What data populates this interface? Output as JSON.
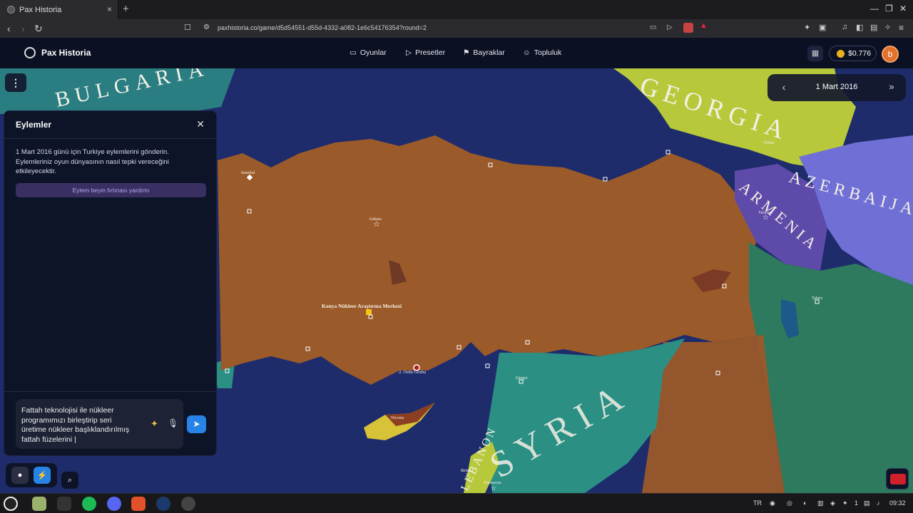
{
  "browser": {
    "tab_title": "Pax Historia",
    "tab_close": "×",
    "new_tab": "+",
    "url": "paxhistoria.co/game/d5d54551-d55d-4332-a082-1e6c54176354?round=2"
  },
  "app": {
    "brand": "Pax Historia",
    "nav": [
      "Oyunlar",
      "Presetler",
      "Bayraklar",
      "Topluluk"
    ],
    "balance": "$0.776",
    "avatar_initial": "b"
  },
  "date": {
    "current": "1 Mart 2016"
  },
  "actions_panel": {
    "title": "Eylemler",
    "description": "1 Mart 2016 günü için Turkiye eylemlerini gönderin. Eylemleriniz oyun dünyasının nasıl tepki vereceğini etkileyecektir.",
    "brainstorm_button": "Eylem beyin fırtınası yardımı",
    "input_value": "Fattah teknolojisi ile nükleer programımızı birleştirip seri üretime nükleer başlıklandırılmış fattah füzelerini |"
  },
  "map": {
    "countries": [
      "BULGARIA",
      "GEORGIA",
      "ARMENIA",
      "AZERBAIJA",
      "SYRIA",
      "LEBANON"
    ],
    "cities": [
      "Istanbul",
      "Ankara",
      "Konya Nükleer Araştırma Merkezi",
      "2. Ordu Grubu",
      "Nicosia",
      "Beirut",
      "Damascus",
      "Yerevan",
      "Tbilisi",
      "Aleppo",
      "Tabriz"
    ]
  },
  "taskbar": {
    "language": "TR",
    "clock": "09:32",
    "badge": "1"
  },
  "colors": {
    "turkey": "#9b5a2a",
    "sea": "#1e2c6c",
    "georgia": "#b7c93a",
    "armenia": "#5e4aa8",
    "azerbaijan": "#6f6fd6",
    "syria": "#2b8f84",
    "iran_iraq": "#2e7a5e",
    "accent": "#2783e6"
  }
}
